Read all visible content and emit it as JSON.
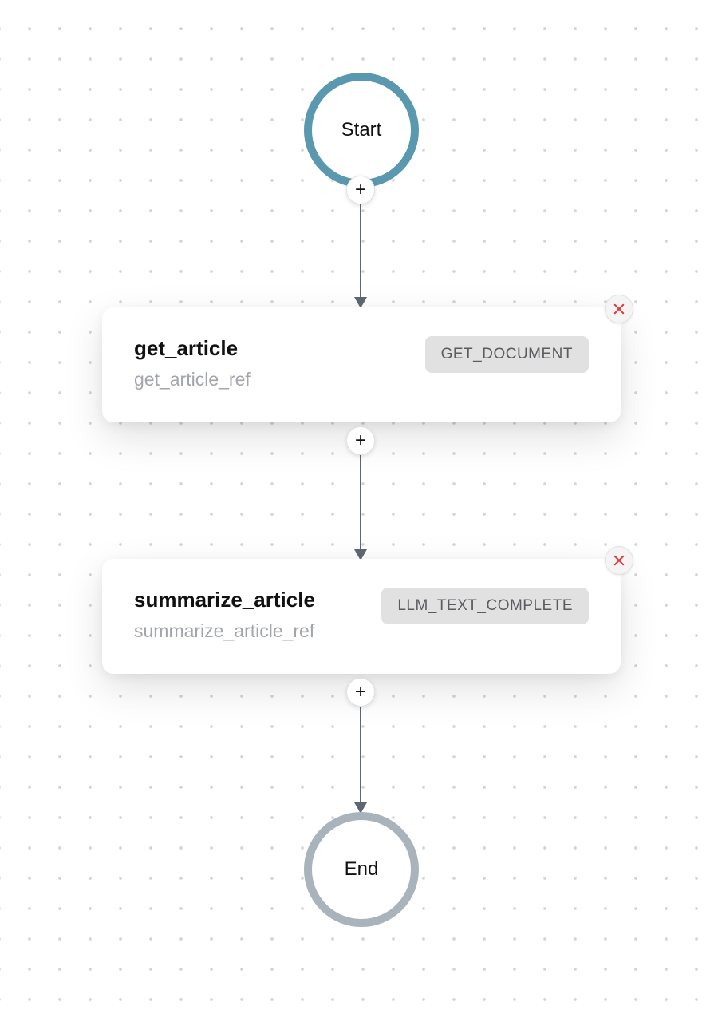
{
  "nodes": {
    "start": {
      "label": "Start"
    },
    "end": {
      "label": "End"
    }
  },
  "steps": [
    {
      "title": "get_article",
      "ref": "get_article_ref",
      "badge": "GET_DOCUMENT"
    },
    {
      "title": "summarize_article",
      "ref": "summarize_article_ref",
      "badge": "LLM_TEXT_COMPLETE"
    }
  ],
  "icons": {
    "plus": "+",
    "close": "×"
  }
}
